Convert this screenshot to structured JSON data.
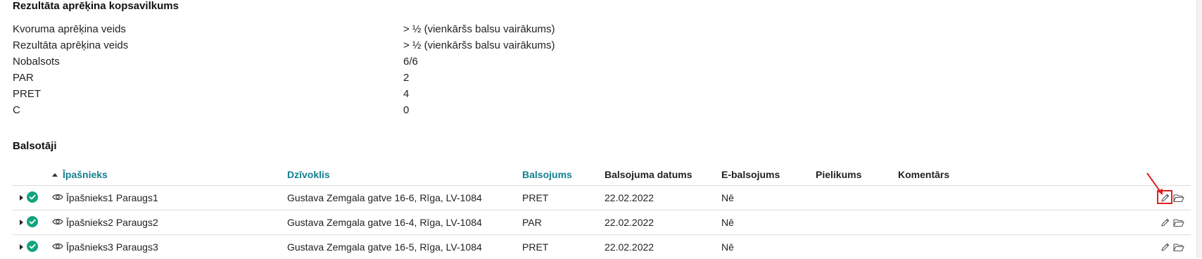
{
  "summary": {
    "title": "Rezultāta aprēķina kopsavilkums",
    "rows": [
      {
        "label": "Kvoruma aprēķina veids",
        "value": "> ½ (vienkāršs balsu vairākums)"
      },
      {
        "label": "Rezultāta aprēķina veids",
        "value": "> ½ (vienkāršs balsu vairākums)"
      },
      {
        "label": "Nobalsots",
        "value": "6/6"
      },
      {
        "label": "PAR",
        "value": "2"
      },
      {
        "label": "PRET",
        "value": "4"
      },
      {
        "label": "C",
        "value": "0"
      }
    ]
  },
  "voters": {
    "title": "Balsotāji",
    "columns": {
      "owner": "Īpašnieks",
      "apartment": "Dzīvoklis",
      "vote": "Balsojums",
      "date": "Balsojuma datums",
      "evote": "E-balsojums",
      "attachment": "Pielikums",
      "comment": "Komentārs"
    },
    "sort": {
      "column": "owner",
      "direction": "ascending"
    },
    "rows": [
      {
        "owner": "Īpašnieks1 Paraugs1",
        "apartment": "Gustava Zemgala gatve 16-6, Rīga, LV-1084",
        "vote": "PRET",
        "date": "22.02.2022",
        "evote": "Nē",
        "status": "voted"
      },
      {
        "owner": "Īpašnieks2 Paraugs2",
        "apartment": "Gustava Zemgala gatve 16-4, Rīga, LV-1084",
        "vote": "PAR",
        "date": "22.02.2022",
        "evote": "Nē",
        "status": "voted"
      },
      {
        "owner": "Īpašnieks3 Paraugs3",
        "apartment": "Gustava Zemgala gatve 16-5, Rīga, LV-1084",
        "vote": "PRET",
        "date": "22.02.2022",
        "evote": "Nē",
        "status": "voted"
      }
    ],
    "row_actions": [
      "edit-icon",
      "folder-icon"
    ]
  },
  "colors": {
    "accent": "#13808f",
    "status_ok": "#14a37f",
    "annotation": "#e02020"
  }
}
